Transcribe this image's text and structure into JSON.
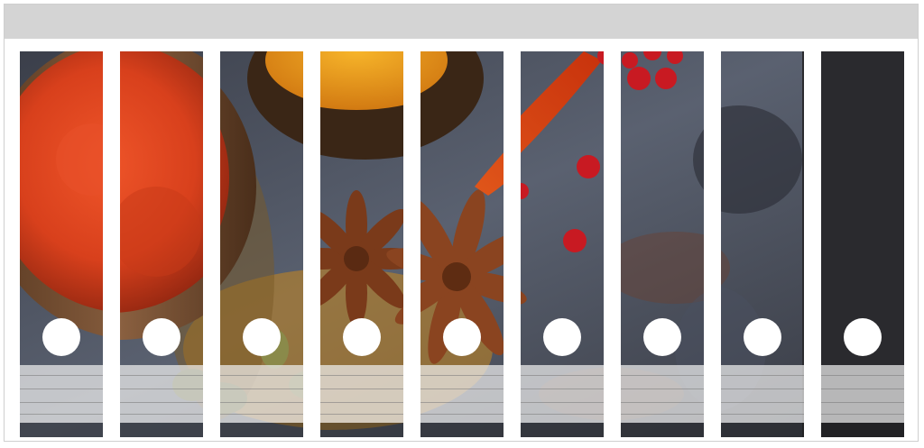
{
  "sheet": {
    "strip_count": 9,
    "background_color": "#ffffff",
    "band_color": "#d4d4d4",
    "label_lines_per_strip": 4
  },
  "image_motifs": {
    "strip_1": "paprika-powder-in-wooden-bowl",
    "strip_2": "paprika-powder-in-wooden-bowl",
    "strip_3": "wooden-bowl-edge-and-cardamom",
    "strip_4": "turmeric-bowl-and-star-anise",
    "strip_5": "star-anise",
    "strip_6": "star-anise-and-red-chili",
    "strip_7": "red-chili-and-pink-peppercorns",
    "strip_8": "pink-peppercorns-on-slate",
    "strip_9": "dark-slate-surface"
  }
}
